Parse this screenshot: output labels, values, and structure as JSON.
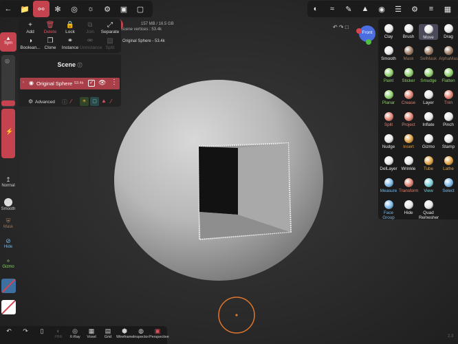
{
  "menu": {
    "row1": [
      {
        "label": "Add",
        "icon": "plus-icon",
        "state": "normal"
      },
      {
        "label": "Delete",
        "icon": "trash-icon",
        "state": "red"
      },
      {
        "label": "Lock",
        "icon": "lock-icon",
        "state": "normal"
      },
      {
        "label": "Join",
        "icon": "join-icon",
        "state": "dim"
      },
      {
        "label": "Separate",
        "icon": "separate-icon",
        "state": "normal"
      }
    ],
    "row2": [
      {
        "label": "Boolean...",
        "icon": "boolean-icon",
        "state": "normal"
      },
      {
        "label": "Clone",
        "icon": "clone-icon",
        "state": "normal"
      },
      {
        "label": "Instance",
        "icon": "instance-icon",
        "state": "normal"
      },
      {
        "label": "Uninstance",
        "icon": "uninstance-icon",
        "state": "dim"
      },
      {
        "label": "Split",
        "icon": "split-icon",
        "state": "dim"
      }
    ]
  },
  "scene": {
    "title": "Scene",
    "object_name": "Original Sphere",
    "object_verts": "53.4k",
    "advanced_label": "Advanced"
  },
  "header_info": {
    "memory": "157 MB / 16.5 GB",
    "scene_vertices": "Scene vertices : 53.4k",
    "selected": "Original Sphere - 53.4k"
  },
  "left": {
    "sym_label": "Sym",
    "normal_label": "Normal",
    "smooth_label": "Smooth",
    "mask_label": "Mask",
    "hide_label": "Hide",
    "gizmo_label": "Gizmo"
  },
  "gizmo_label": "Front",
  "tools": [
    {
      "label": "Clay",
      "color": "#e6e6e6"
    },
    {
      "label": "Brush",
      "color": "#e6e6e6"
    },
    {
      "label": "Move",
      "color": "#e6e6e6",
      "active": true
    },
    {
      "label": "Drag",
      "color": "#e6e6e6"
    },
    {
      "label": "Smooth",
      "color": "#e6e6e6"
    },
    {
      "label": "Mask",
      "color": "#9a7a62"
    },
    {
      "label": "SelMask",
      "color": "#9a7a62"
    },
    {
      "label": "AlphaMask",
      "color": "#9a7a62"
    },
    {
      "label": "Paint",
      "color": "#8ed06a"
    },
    {
      "label": "Sticker",
      "color": "#8ed06a"
    },
    {
      "label": "Smudge",
      "color": "#8ed06a"
    },
    {
      "label": "Flatten",
      "color": "#8ed06a"
    },
    {
      "label": "Planar",
      "color": "#8ed06a"
    },
    {
      "label": "Crease",
      "color": "#e08070"
    },
    {
      "label": "Layer",
      "color": "#e6e6e6"
    },
    {
      "label": "Trim",
      "color": "#e08070"
    },
    {
      "label": "Split",
      "color": "#e08070"
    },
    {
      "label": "Project",
      "color": "#e08070"
    },
    {
      "label": "Inflate",
      "color": "#e6e6e6"
    },
    {
      "label": "Pinch",
      "color": "#e6e6e6"
    },
    {
      "label": "Nudge",
      "color": "#e6e6e6"
    },
    {
      "label": "Insert",
      "color": "#e0a040"
    },
    {
      "label": "Gizmo",
      "color": "#e6e6e6"
    },
    {
      "label": "Stamp",
      "color": "#e6e6e6"
    },
    {
      "label": "DelLayer",
      "color": "#e6e6e6"
    },
    {
      "label": "Wrinkle",
      "color": "#e6e6e6"
    },
    {
      "label": "Tube",
      "color": "#e0a040"
    },
    {
      "label": "Lathe",
      "color": "#e0a040"
    },
    {
      "label": "Measure",
      "color": "#7ab8e8"
    },
    {
      "label": "Transform",
      "color": "#e08070"
    },
    {
      "label": "View",
      "color": "#7ad0d8"
    },
    {
      "label": "Select",
      "color": "#7ab8e8"
    },
    {
      "label": "Face Group",
      "color": "#7ab8e8"
    },
    {
      "label": "Hide",
      "color": "#e6e6e6"
    },
    {
      "label": "Quad Remesher",
      "color": "#e6e6e6"
    }
  ],
  "bottom": [
    {
      "label": "",
      "icon": "undo-icon"
    },
    {
      "label": "",
      "icon": "redo-icon"
    },
    {
      "label": "",
      "icon": "file-icon"
    },
    {
      "label": "PBR",
      "icon": "pbr-icon"
    },
    {
      "label": "X-Ray",
      "icon": "xray-icon"
    },
    {
      "label": "Voxel",
      "icon": "voxel-icon"
    },
    {
      "label": "Grid",
      "icon": "grid-icon"
    },
    {
      "label": "Wireframe",
      "icon": "wireframe-icon"
    },
    {
      "label": "Inspector",
      "icon": "inspector-icon"
    },
    {
      "label": "Perspective",
      "icon": "perspective-icon"
    }
  ],
  "version": "2.3"
}
